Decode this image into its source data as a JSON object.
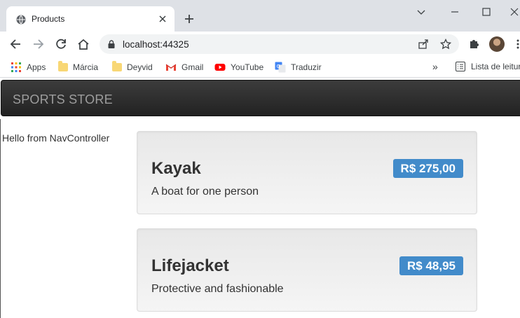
{
  "browser": {
    "tab_title": "Products",
    "url": "localhost:44325",
    "bookmarks": [
      {
        "label": "Apps",
        "icon": "apps-grid-icon"
      },
      {
        "label": "Márcia",
        "icon": "folder-icon"
      },
      {
        "label": "Deyvid",
        "icon": "folder-icon"
      },
      {
        "label": "Gmail",
        "icon": "gmail-icon"
      },
      {
        "label": "YouTube",
        "icon": "youtube-icon"
      },
      {
        "label": "Traduzir",
        "icon": "google-translate-icon"
      }
    ],
    "overflow_label": "»",
    "reading_list_label": "Lista de leitura",
    "colors": {
      "tabstrip": "#dee1e6",
      "omnibox": "#f1f3f4"
    }
  },
  "site": {
    "brand": "SPORTS STORE",
    "nav_message": "Hello from NavController",
    "products": [
      {
        "name": "Kayak",
        "price": "R$ 275,00",
        "description": "A boat for one person"
      },
      {
        "name": "Lifejacket",
        "price": "R$ 48,95",
        "description": "Protective and fashionable"
      }
    ],
    "colors": {
      "navbar": "#222222",
      "price_badge": "#428bca"
    }
  }
}
